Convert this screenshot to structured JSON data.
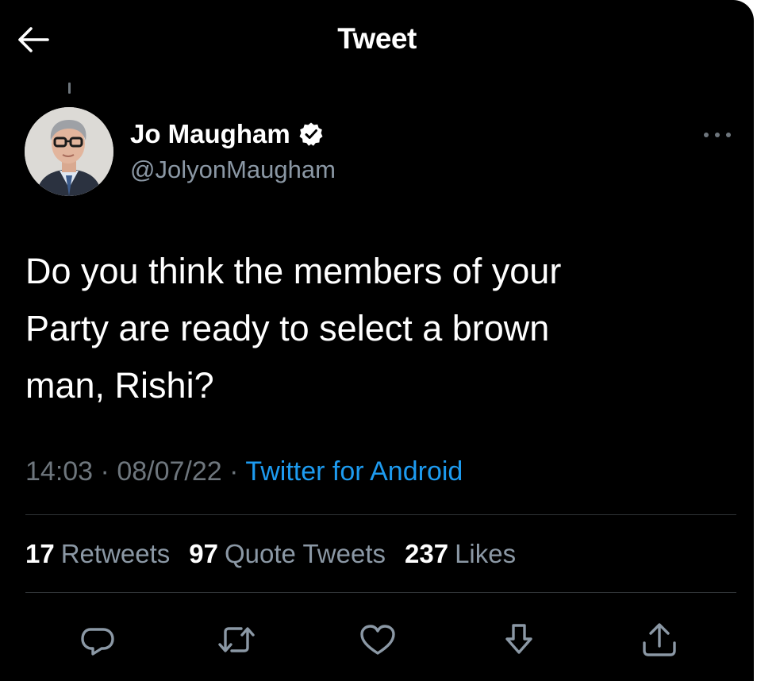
{
  "header": {
    "title": "Tweet",
    "back_icon": "arrow-left-icon"
  },
  "author": {
    "name": "Jo Maugham",
    "handle": "@JolyonMaugham",
    "verified_icon": "verified-badge-icon",
    "more_icon": "more-horizontal-icon"
  },
  "tweet": {
    "text": "Do you think the members of your\nParty are ready to select a brown\nman, Rishi?",
    "time": "14:03",
    "separator": "·",
    "date": "08/07/22",
    "source": "Twitter for Android"
  },
  "stats": {
    "retweets_count": "17",
    "retweets_label": "Retweets",
    "quotes_count": "97",
    "quotes_label": "Quote Tweets",
    "likes_count": "237",
    "likes_label": "Likes"
  },
  "actions": [
    {
      "name": "reply",
      "icon": "reply-icon"
    },
    {
      "name": "retweet",
      "icon": "retweet-icon"
    },
    {
      "name": "like",
      "icon": "heart-icon"
    },
    {
      "name": "bookmark",
      "icon": "download-arrow-icon"
    },
    {
      "name": "share",
      "icon": "share-icon"
    }
  ],
  "colors": {
    "background": "#000000",
    "text": "#ffffff",
    "secondary": "#8b98a5",
    "muted": "#6e767d",
    "accent": "#1d9bf0",
    "divider": "#2f3336"
  }
}
